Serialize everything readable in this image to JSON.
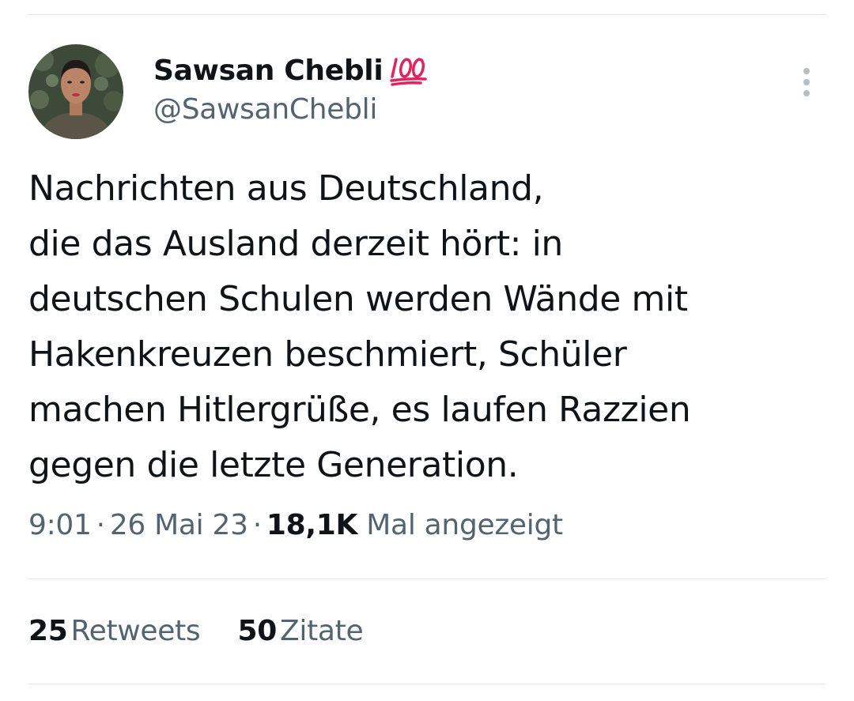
{
  "author": {
    "display_name": "Sawsan Chebli",
    "handle": "@SawsanChebli",
    "name_emoji_icon": "hundred-points-icon"
  },
  "tweet": {
    "lines": [
      "Nachrichten aus Deutschland,",
      "die das Ausland derzeit hört: in",
      "deutschen Schulen werden Wände mit",
      "Hakenkreuzen beschmiert, Schüler",
      "machen Hitlergrüße, es laufen Razzien",
      "gegen die letzte Generation."
    ]
  },
  "meta": {
    "time": "9:01",
    "separator": "·",
    "date": "26 Mai 23",
    "views_count": "18,1K",
    "views_label": "Mal angezeigt"
  },
  "stats": {
    "retweets_count": "25",
    "retweets_label": "Retweets",
    "quotes_count": "50",
    "quotes_label": "Zitate"
  },
  "colors": {
    "text_primary": "#0f1419",
    "text_secondary": "#536471",
    "divider": "#e3e6e9",
    "emoji_red": "#e0245e"
  }
}
